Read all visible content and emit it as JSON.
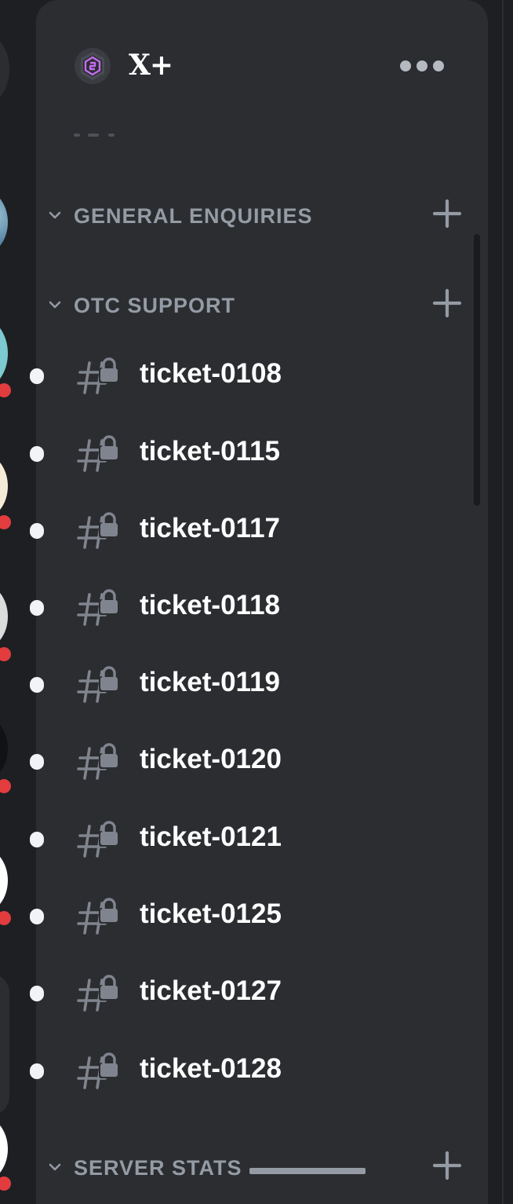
{
  "server": {
    "name": "X+",
    "icon": "hexagon-logo-icon",
    "accent": "#c56cf0"
  },
  "header": {
    "more_icon": "more-dots-icon"
  },
  "categories": [
    {
      "label": "GENERAL ENQUIRIES"
    },
    {
      "label": "OTC SUPPORT"
    },
    {
      "label": "SERVER STATS"
    }
  ],
  "channels": [
    {
      "name": "ticket-0108",
      "icon": "locked-text-channel-icon",
      "unread": true
    },
    {
      "name": "ticket-0115",
      "icon": "locked-text-channel-icon",
      "unread": true
    },
    {
      "name": "ticket-0117",
      "icon": "locked-text-channel-icon",
      "unread": true
    },
    {
      "name": "ticket-0118",
      "icon": "locked-text-channel-icon",
      "unread": true
    },
    {
      "name": "ticket-0119",
      "icon": "locked-text-channel-icon",
      "unread": true
    },
    {
      "name": "ticket-0120",
      "icon": "locked-text-channel-icon",
      "unread": true
    },
    {
      "name": "ticket-0121",
      "icon": "locked-text-channel-icon",
      "unread": true
    },
    {
      "name": "ticket-0125",
      "icon": "locked-text-channel-icon",
      "unread": true
    },
    {
      "name": "ticket-0127",
      "icon": "locked-text-channel-icon",
      "unread": true
    },
    {
      "name": "ticket-0128",
      "icon": "locked-text-channel-icon",
      "unread": true
    }
  ],
  "colors": {
    "sidebar_bg": "#2b2d31",
    "app_bg": "#1e1f22",
    "muted_text": "#949ba4",
    "channel_text": "#ffffff",
    "mention_badge": "#e23c3f"
  }
}
